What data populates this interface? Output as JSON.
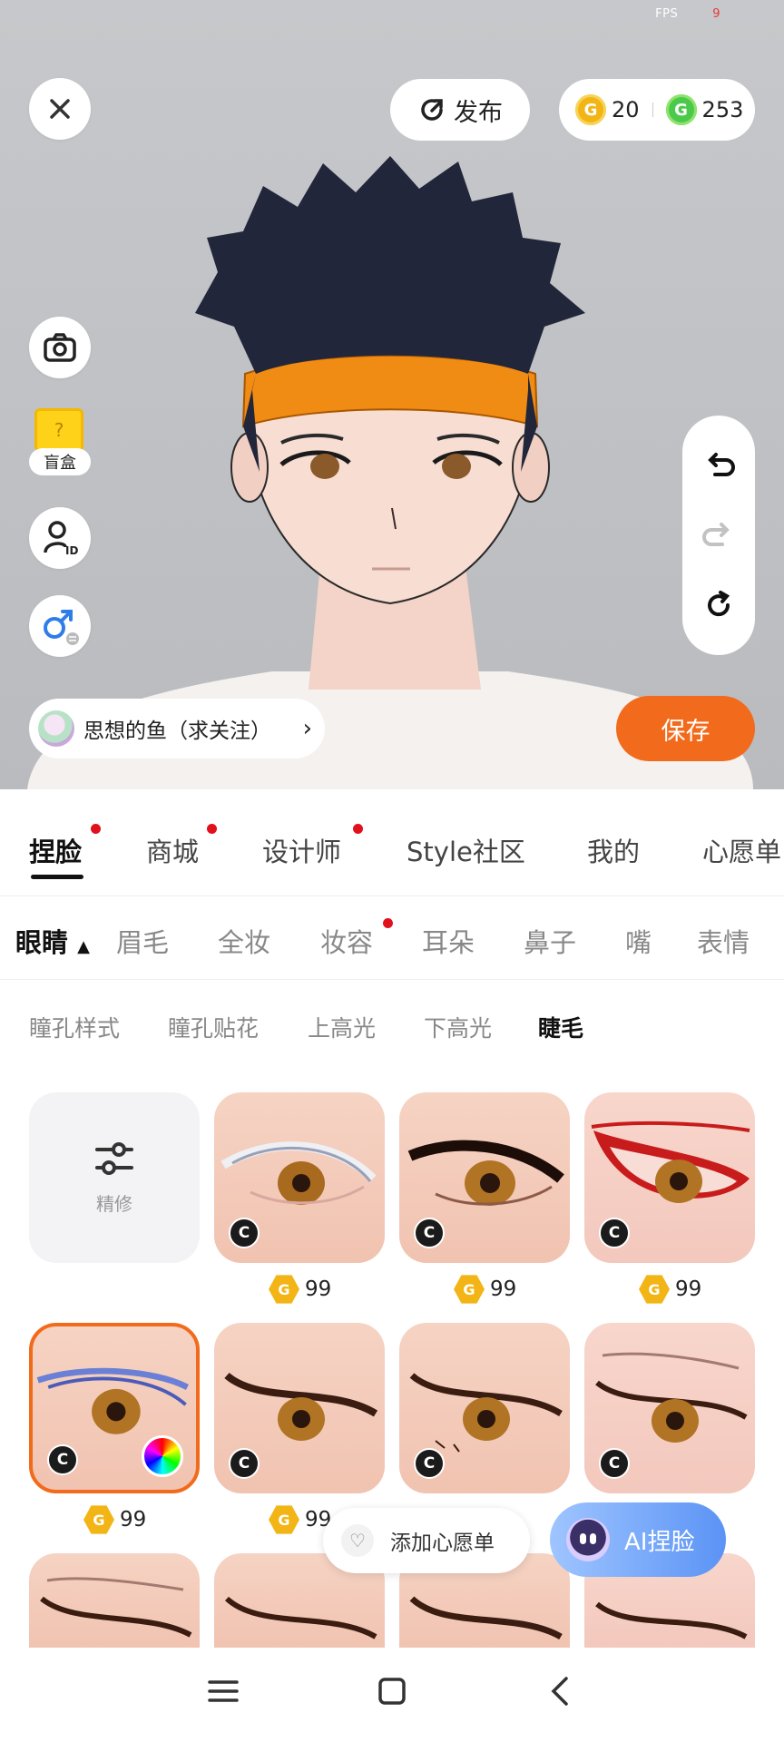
{
  "status": {
    "fps_label": "FPS",
    "fps_value": "9"
  },
  "header": {
    "publish_label": "发布",
    "gold_coins": "20",
    "green_coins": "253"
  },
  "left_tools": {
    "blindbox_label": "盲盒"
  },
  "author": {
    "name": "思想的鱼（求关注）"
  },
  "save_label": "保存",
  "tabs": [
    {
      "label": "捏脸",
      "active": true,
      "dot": true
    },
    {
      "label": "商城",
      "dot": true
    },
    {
      "label": "设计师",
      "dot": true
    },
    {
      "label": "Style社区"
    },
    {
      "label": "我的"
    },
    {
      "label": "心愿单"
    }
  ],
  "subtabs": [
    {
      "label": "眼睛",
      "active": true
    },
    {
      "label": "眉毛"
    },
    {
      "label": "全妆"
    },
    {
      "label": "妆容",
      "dot": true
    },
    {
      "label": "耳朵"
    },
    {
      "label": "鼻子"
    },
    {
      "label": "嘴"
    },
    {
      "label": "表情"
    }
  ],
  "subsubtabs": [
    {
      "label": "瞳孔样式"
    },
    {
      "label": "瞳孔贴花"
    },
    {
      "label": "上高光"
    },
    {
      "label": "下高光"
    },
    {
      "label": "睫毛",
      "active": true
    }
  ],
  "grid": {
    "finetune_label": "精修",
    "badge_letter": "C",
    "prices": [
      "99",
      "99",
      "99",
      "99",
      "99"
    ]
  },
  "wishlist_label": "添加心愿单",
  "ai_label": "AI捏脸",
  "colors": {
    "accent": "#f26a1b",
    "dot": "#e0101c",
    "gold": "#f2b515",
    "green": "#4bc94b"
  },
  "icons": [
    "close-icon",
    "publish-refresh-icon",
    "camera-icon",
    "profile-id-icon",
    "gender-switch-icon",
    "undo-icon",
    "redo-icon",
    "reset-icon",
    "chevron-right-icon",
    "sliders-icon",
    "heart-icon",
    "menu-icon",
    "home-square-icon",
    "back-icon"
  ]
}
